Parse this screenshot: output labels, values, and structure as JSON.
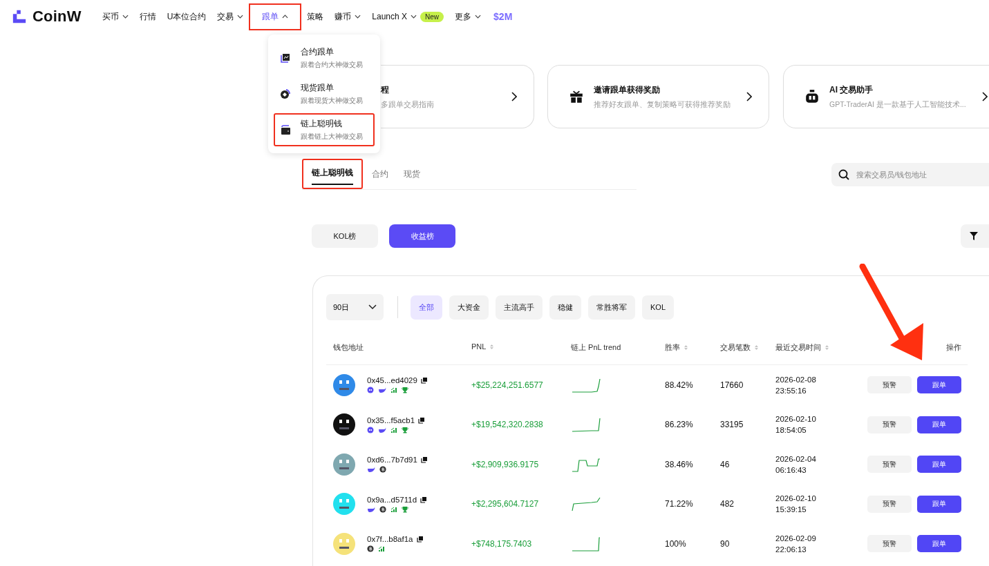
{
  "logo": {
    "name": "CoinW"
  },
  "nav": [
    {
      "kind": "menu",
      "label": "买币",
      "expanded": false,
      "selected": false,
      "highlighted": false
    },
    {
      "kind": "link",
      "label": "行情",
      "selected": false,
      "highlighted": false
    },
    {
      "kind": "link",
      "label": "U本位合约",
      "selected": false,
      "highlighted": false
    },
    {
      "kind": "menu",
      "label": "交易",
      "expanded": false,
      "selected": false,
      "highlighted": false
    },
    {
      "kind": "menu",
      "label": "跟单",
      "expanded": true,
      "selected": true,
      "highlighted": true
    },
    {
      "kind": "link",
      "label": "策略",
      "selected": false,
      "highlighted": false
    },
    {
      "kind": "menu",
      "label": "赚币",
      "expanded": false,
      "selected": false,
      "highlighted": false
    },
    {
      "kind": "menu",
      "label": "Launch X",
      "expanded": false,
      "badge": "New",
      "selected": false,
      "highlighted": false
    },
    {
      "kind": "menu",
      "label": "更多",
      "expanded": false,
      "selected": false,
      "highlighted": false
    }
  ],
  "promo": {
    "label": "$2M"
  },
  "dropdown": [
    {
      "kind": "chart",
      "title": "合约跟单",
      "subtitle": "跟着合约大神做交易",
      "highlighted": false
    },
    {
      "kind": "coin",
      "title": "现货跟单",
      "subtitle": "跟着现货大神做交易",
      "highlighted": false
    },
    {
      "kind": "wallet",
      "title": "链上聪明钱",
      "subtitle": "跟着链上大神做交易",
      "highlighted": true
    }
  ],
  "cards": [
    {
      "kind": "covered",
      "title": "程",
      "subtitle": "多跟单交易指南"
    },
    {
      "kind": "gift",
      "title": "邀请跟单获得奖励",
      "subtitle": "推荐好友跟单、复制策略可获得推荐奖励"
    },
    {
      "kind": "robot",
      "title": "AI 交易助手",
      "subtitle": "GPT-TraderAI 是一款基于人工智能技术..."
    }
  ],
  "tabs": [
    {
      "label": "链上聪明钱",
      "selected": true,
      "highlighted": true
    },
    {
      "label": "合约",
      "selected": false,
      "highlighted": false
    },
    {
      "label": "现货",
      "selected": false,
      "highlighted": false
    }
  ],
  "search": {
    "placeholder": "搜索交易员/钱包地址"
  },
  "boards": [
    {
      "label": "KOL榜",
      "selected": false
    },
    {
      "label": "收益榜",
      "selected": true
    }
  ],
  "period": {
    "value": "90日"
  },
  "chips": [
    {
      "label": "全部",
      "selected": true
    },
    {
      "label": "大资金",
      "selected": false
    },
    {
      "label": "主流高手",
      "selected": false
    },
    {
      "label": "稳健",
      "selected": false
    },
    {
      "label": "常胜将军",
      "selected": false
    },
    {
      "label": "KOL",
      "selected": false
    }
  ],
  "table": {
    "columns": [
      {
        "label": "钱包地址",
        "sortable": false
      },
      {
        "label": "PNL",
        "sortable": true
      },
      {
        "label": "链上 PnL trend",
        "sortable": false
      },
      {
        "label": "胜率",
        "sortable": true
      },
      {
        "label": "交易笔数",
        "sortable": true
      },
      {
        "label": "最近交易时间",
        "sortable": true
      },
      {
        "label": "操作",
        "sortable": false
      }
    ],
    "rows": [
      {
        "color": "#2f8ae8",
        "address": "0x45...ed4029",
        "badges": [
          {
            "kind": "bot"
          },
          {
            "kind": "whale"
          },
          {
            "kind": "signal"
          },
          {
            "kind": "trophy"
          }
        ],
        "pnl": "+$25,224,251.6577",
        "win_rate": "88.42%",
        "trades": "17660",
        "date": "2026-02-08",
        "time": "23:55:16",
        "alert": "预警",
        "follow": "跟单"
      },
      {
        "color": "#111111",
        "address": "0x35...f5acb1",
        "badges": [
          {
            "kind": "bot"
          },
          {
            "kind": "whale"
          },
          {
            "kind": "signal"
          },
          {
            "kind": "trophy"
          }
        ],
        "pnl": "+$19,542,320.2838",
        "win_rate": "86.23%",
        "trades": "33195",
        "date": "2026-02-10",
        "time": "18:54:05",
        "alert": "预警",
        "follow": "跟单"
      },
      {
        "color": "#7fa8b0",
        "address": "0xd6...7b7d91",
        "badges": [
          {
            "kind": "whale"
          },
          {
            "kind": "bitcoin"
          }
        ],
        "pnl": "+$2,909,936.9175",
        "win_rate": "38.46%",
        "trades": "46",
        "date": "2026-02-04",
        "time": "06:16:43",
        "alert": "预警",
        "follow": "跟单"
      },
      {
        "color": "#22e0ee",
        "address": "0x9a...d5711d",
        "badges": [
          {
            "kind": "whale"
          },
          {
            "kind": "bitcoin"
          },
          {
            "kind": "signal"
          },
          {
            "kind": "trophy"
          }
        ],
        "pnl": "+$2,295,604.7127",
        "win_rate": "71.22%",
        "trades": "482",
        "date": "2026-02-10",
        "time": "15:39:15",
        "alert": "预警",
        "follow": "跟单"
      },
      {
        "color": "#f5e27a",
        "address": "0x7f...b8af1a",
        "badges": [
          {
            "kind": "bitcoin"
          },
          {
            "kind": "signal"
          }
        ],
        "pnl": "+$748,175.7403",
        "win_rate": "100%",
        "trades": "90",
        "date": "2026-02-09",
        "time": "22:06:13",
        "alert": "预警",
        "follow": "跟单"
      }
    ]
  }
}
